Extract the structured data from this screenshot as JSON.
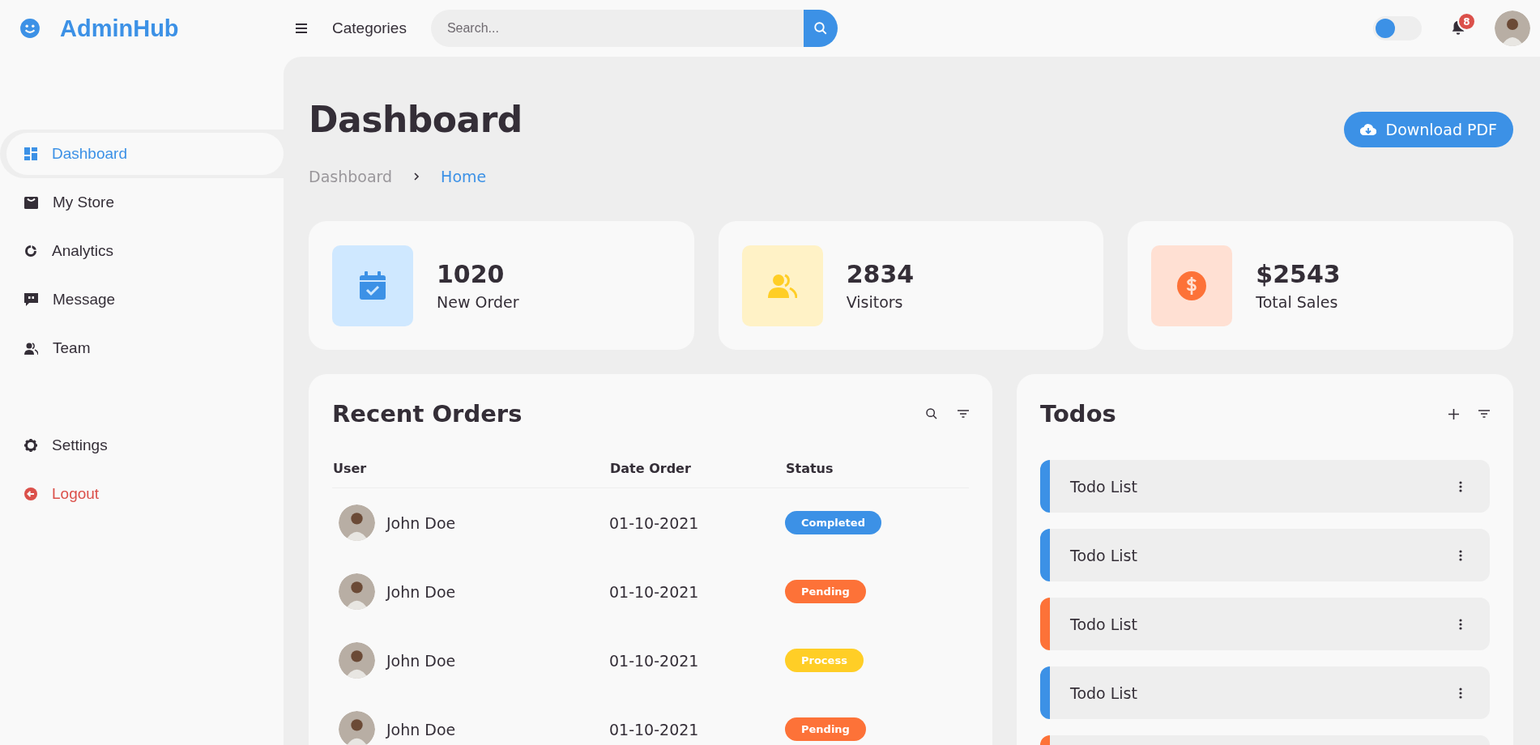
{
  "brand": {
    "name": "AdminHub"
  },
  "header": {
    "menu_label": "Categories",
    "search": {
      "placeholder": "Search..."
    },
    "theme_toggle": {
      "on": false
    },
    "notifications": {
      "count": "8"
    }
  },
  "sidebar": {
    "items": [
      {
        "kind": "dashboard",
        "label": "Dashboard",
        "selected": true
      },
      {
        "kind": "store",
        "label": "My Store",
        "selected": false
      },
      {
        "kind": "analytics",
        "label": "Analytics",
        "selected": false
      },
      {
        "kind": "message",
        "label": "Message",
        "selected": false
      },
      {
        "kind": "team",
        "label": "Team",
        "selected": false
      }
    ],
    "bottom_items": [
      {
        "kind": "settings",
        "label": "Settings"
      },
      {
        "kind": "logout",
        "label": "Logout"
      }
    ]
  },
  "main": {
    "title": "Dashboard",
    "breadcrumb": [
      {
        "label": "Dashboard",
        "selected": false
      },
      {
        "label": "Home",
        "selected": true
      }
    ],
    "download_button": "Download PDF"
  },
  "stats": [
    {
      "kind": "orders",
      "value": "1020",
      "label": "New Order"
    },
    {
      "kind": "visitors",
      "value": "2834",
      "label": "Visitors"
    },
    {
      "kind": "sales",
      "value": "$2543",
      "label": "Total Sales"
    }
  ],
  "recent_orders": {
    "title": "Recent Orders",
    "columns": [
      "User",
      "Date Order",
      "Status"
    ],
    "rows": [
      {
        "user": "John Doe",
        "date": "01-10-2021",
        "status": {
          "kind": "completed",
          "label": "Completed"
        }
      },
      {
        "user": "John Doe",
        "date": "01-10-2021",
        "status": {
          "kind": "pending",
          "label": "Pending"
        }
      },
      {
        "user": "John Doe",
        "date": "01-10-2021",
        "status": {
          "kind": "process",
          "label": "Process"
        }
      },
      {
        "user": "John Doe",
        "date": "01-10-2021",
        "status": {
          "kind": "pending",
          "label": "Pending"
        }
      }
    ]
  },
  "todos": {
    "title": "Todos",
    "items": [
      {
        "label": "Todo List",
        "color": "#3c91e6"
      },
      {
        "label": "Todo List",
        "color": "#3c91e6"
      },
      {
        "label": "Todo List",
        "color": "#fd7238"
      },
      {
        "label": "Todo List",
        "color": "#3c91e6"
      },
      {
        "color": "#fd7238"
      }
    ]
  }
}
